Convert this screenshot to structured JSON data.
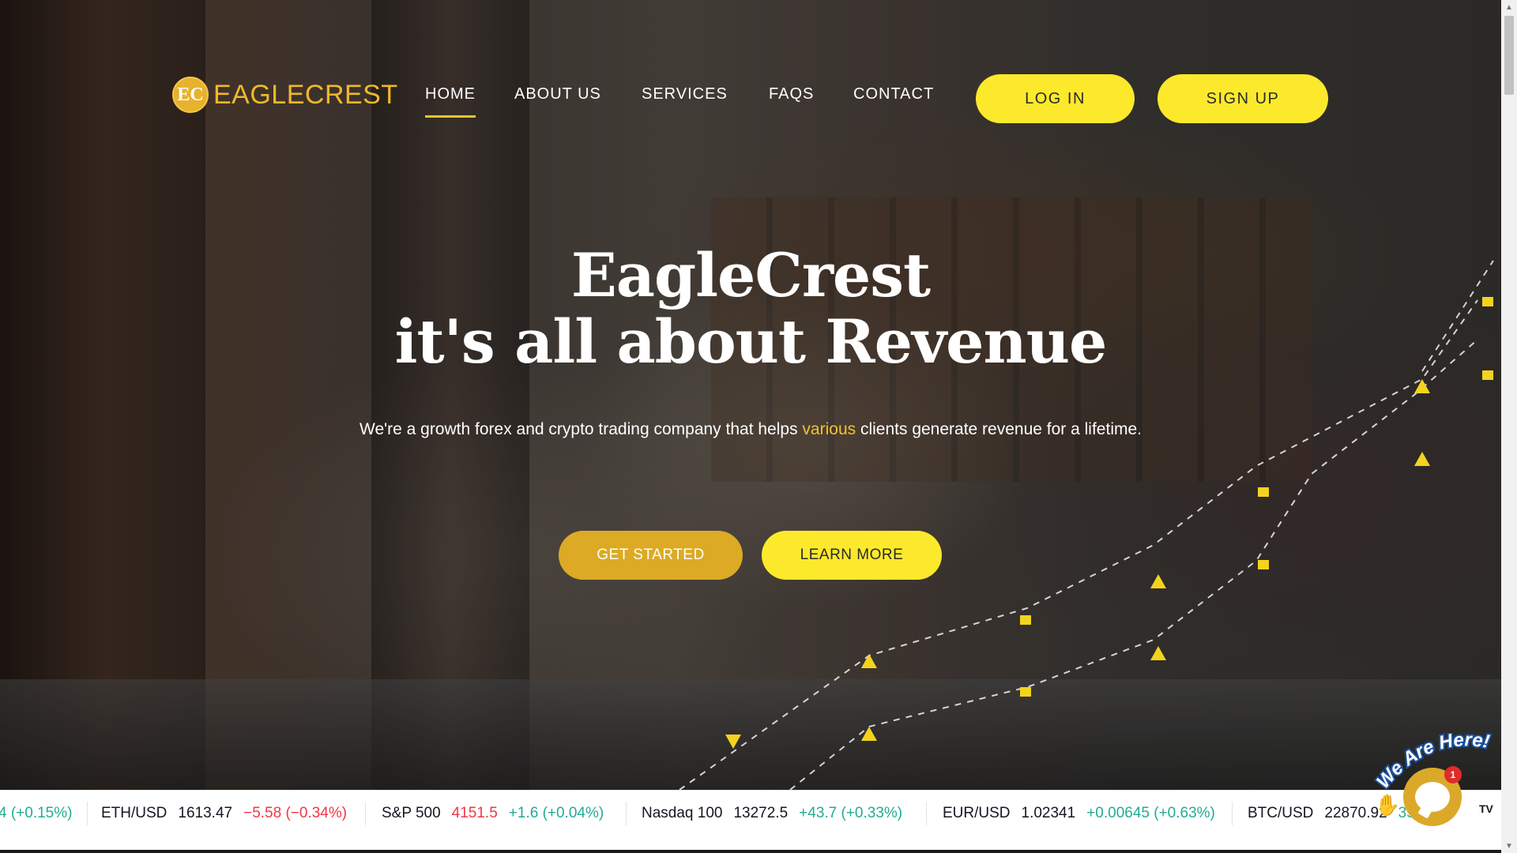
{
  "brand": {
    "logo_initials": "EC",
    "name": "EAGLECREST"
  },
  "nav": {
    "items": [
      {
        "label": "HOME",
        "active": true
      },
      {
        "label": "ABOUT US",
        "active": false
      },
      {
        "label": "SERVICES",
        "active": false
      },
      {
        "label": "FAQS",
        "active": false
      },
      {
        "label": "CONTACT",
        "active": false
      }
    ],
    "login_label": "LOG IN",
    "signup_label": "SIGN UP"
  },
  "hero": {
    "title_line1": "EagleCrest",
    "title_line2": "it's all about Revenue",
    "subtitle_before": "We're a growth forex and crypto trading company that helps ",
    "subtitle_highlight": "various",
    "subtitle_after": " clients generate revenue for a lifetime.",
    "get_started_label": "GET STARTED",
    "learn_more_label": "LEARN MORE"
  },
  "ticker": [
    {
      "symbol": "",
      "price": "",
      "change": "4 (+0.15%)",
      "direction": "up"
    },
    {
      "symbol": "ETH/USD",
      "price": "1613.47",
      "change": "−5.58 (−0.34%)",
      "direction": "down"
    },
    {
      "symbol": "S&P 500",
      "price": "4151.5",
      "change": "+1.6 (+0.04%)",
      "direction": "up",
      "price_down": true
    },
    {
      "symbol": "Nasdaq 100",
      "price": "13272.5",
      "change": "+43.7 (+0.33%)",
      "direction": "up"
    },
    {
      "symbol": "EUR/USD",
      "price": "1.02341",
      "change": "+0.00645 (+0.63%)",
      "direction": "up"
    },
    {
      "symbol": "BTC/USD",
      "price": "22870.92",
      "change": "35",
      "direction": "up"
    }
  ],
  "chat": {
    "badge_text": "We Are Here!",
    "unread_count": "1"
  },
  "widget_mark": "TV",
  "colors": {
    "accent_yellow": "#fde92b",
    "accent_gold": "#dcaa25",
    "logo_gold": "#f0b82a",
    "ticker_up": "#22ab94",
    "ticker_down": "#f23645"
  }
}
